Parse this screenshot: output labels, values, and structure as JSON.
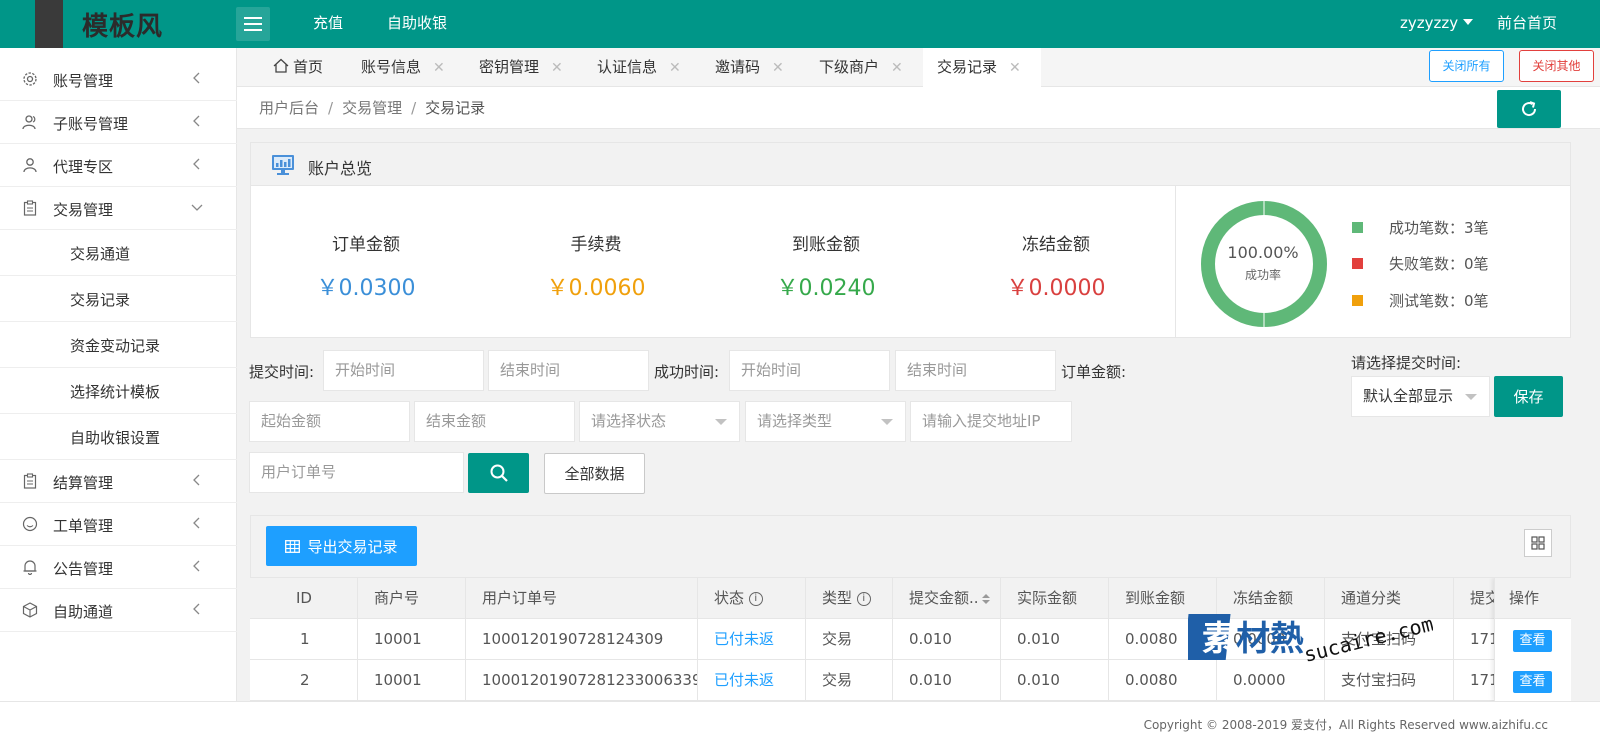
{
  "header": {
    "logo_text": "模板风",
    "nav_left": [
      "充值",
      "自助收银"
    ],
    "username": "zyzyzzy",
    "home_link": "前台首页"
  },
  "sidebar": {
    "items": [
      {
        "label": "账号管理",
        "icon": "gear-icon"
      },
      {
        "label": "子账号管理",
        "icon": "users-icon"
      },
      {
        "label": "代理专区",
        "icon": "user-icon"
      },
      {
        "label": "交易管理",
        "icon": "clipboard-icon"
      },
      {
        "label": "结算管理",
        "icon": "clipboard-icon"
      },
      {
        "label": "工单管理",
        "icon": "smile-icon"
      },
      {
        "label": "公告管理",
        "icon": "bell-icon"
      },
      {
        "label": "自助通道",
        "icon": "cube-icon"
      }
    ],
    "subitems": [
      "交易通道",
      "交易记录",
      "资金变动记录",
      "选择统计模板",
      "自助收银设置"
    ]
  },
  "tabs": {
    "items": [
      "首页",
      "账号信息",
      "密钥管理",
      "认证信息",
      "邀请码",
      "下级商户",
      "交易记录"
    ],
    "close_all": "关闭所有",
    "close_others": "关闭其他"
  },
  "breadcrumb": [
    "用户后台",
    "交易管理",
    "交易记录"
  ],
  "overview": {
    "title": "账户总览",
    "stats": [
      {
        "label": "订单金额",
        "value": "￥0.0300",
        "color": "#3b8fd8"
      },
      {
        "label": "手续费",
        "value": "￥0.0060",
        "color": "#f0a00c"
      },
      {
        "label": "到账金额",
        "value": "￥0.0240",
        "color": "#36a94b"
      },
      {
        "label": "冻结金额",
        "value": "￥0.0000",
        "color": "#d9403f"
      }
    ],
    "rate": "100.00%",
    "rate_label": "成功率",
    "rate_value": 1.0,
    "legend": [
      {
        "label": "成功笔数：3笔",
        "color": "#5fb878"
      },
      {
        "label": "失败笔数：0笔",
        "color": "#e2403d"
      },
      {
        "label": "测试笔数：0笔",
        "color": "#f0a00c"
      }
    ]
  },
  "filters": {
    "submit_time_label": "提交时间:",
    "success_time_label": "成功时间:",
    "amount_label": "订单金额:",
    "start_time_ph": "开始时间",
    "end_time_ph": "结束时间",
    "min_amount_ph": "起始金额",
    "max_amount_ph": "结束金额",
    "status_ph": "请选择状态",
    "type_ph": "请选择类型",
    "ip_ph": "请输入提交地址IP",
    "order_no_ph": "用户订单号",
    "all_data": "全部数据",
    "submit_time_select_label": "请选择提交时间:",
    "submit_time_select_value": "默认全部显示",
    "save": "保存"
  },
  "table": {
    "export_label": "导出交易记录",
    "columns": [
      "ID",
      "商户号",
      "用户订单号",
      "状态",
      "类型",
      "提交金额..",
      "实际金额",
      "到账金额",
      "冻结金额",
      "通道分类",
      "提交"
    ],
    "op_header": "操作",
    "view_label": "查看",
    "rows": [
      [
        "1",
        "10001",
        "1000120190728124309",
        "已付未返",
        "交易",
        "0.010",
        "0.010",
        "0.0080",
        "0.0000",
        "支付宝扫码",
        "171"
      ],
      [
        "2",
        "10001",
        "10001201907281233006339",
        "已付未返",
        "交易",
        "0.010",
        "0.010",
        "0.0080",
        "0.0000",
        "支付宝扫码",
        "171"
      ]
    ]
  },
  "watermark": {
    "text": "素材熱",
    "url": "sucaire.com"
  },
  "footer": {
    "copyright": "Copyright © 2008-2019 爱支付，All Rights Reserved www.aizhifu.cc"
  }
}
